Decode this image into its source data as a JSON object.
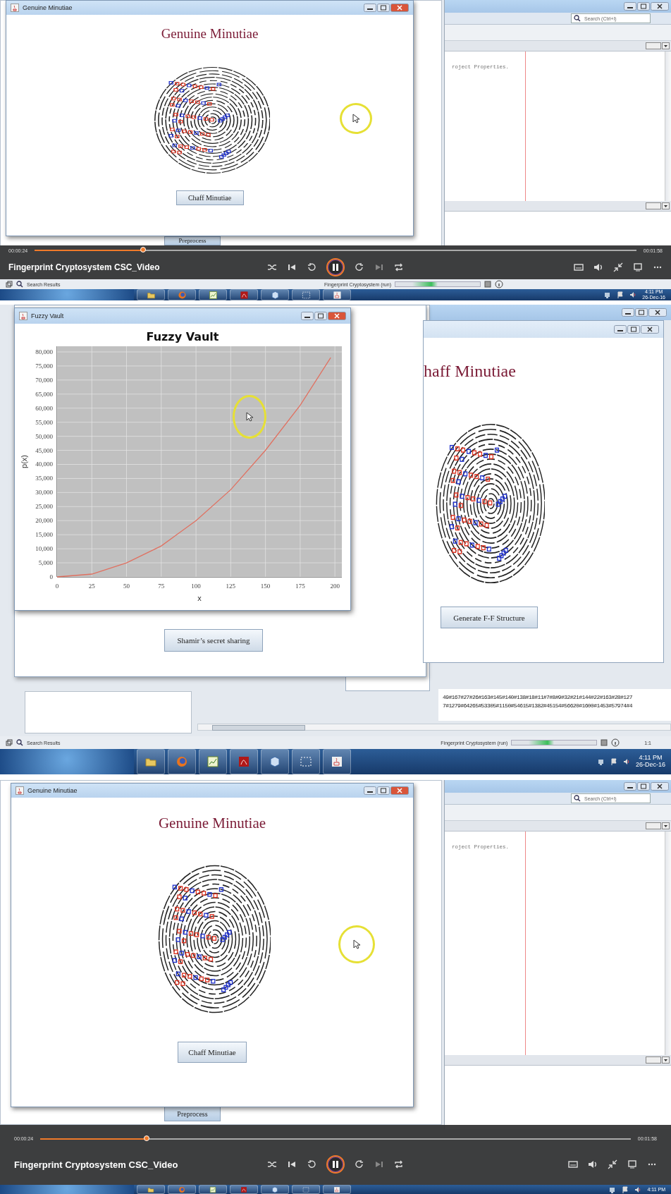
{
  "frames": [
    {
      "kind": "genuine",
      "ide": {
        "search_placeholder": "Search (Ctrl+I)",
        "editor_text": "roject Properties."
      },
      "back_window": {
        "button": "Preprocess"
      },
      "window": {
        "title": "Genuine Minutiae",
        "heading": "Genuine Minutiae",
        "button": "Chaff Minutiae"
      },
      "player": {
        "elapsed": "00:00:24",
        "total": "00:01:58",
        "level": 0.18,
        "playing": true,
        "title": "Fingerprint Cryptosystem CSC_Video"
      },
      "status_bar": {
        "search_results": "Search Results",
        "task": "Fingerprint Cryptosystem (run)",
        "task_progress": {
          "level": 0.5
        }
      },
      "taskbar": {
        "time": "4:11 PM",
        "date": "26-Dec-16"
      }
    },
    {
      "kind": "fuzzy",
      "back_window": {
        "button": "Shamir’s secret sharing"
      },
      "chaff_window": {
        "heading": "haff Minutiae",
        "button": "Generate F-F Structure"
      },
      "chart_window": {
        "title": "Fuzzy Vault",
        "chart_data": {
          "type": "line",
          "title": "Fuzzy Vault",
          "xlabel": "x",
          "ylabel": "p(x)",
          "x": [
            0,
            25,
            50,
            75,
            100,
            125,
            150,
            175,
            197
          ],
          "grid": true,
          "series": [
            {
              "color": "#e07060",
              "values": [
                0,
                1000,
                5000,
                11000,
                20000,
                31000,
                45000,
                61000,
                78000
              ]
            }
          ],
          "xlim": [
            0,
            205
          ],
          "ylim": [
            0,
            82000
          ],
          "xticks": [
            0,
            25,
            50,
            75,
            100,
            125,
            150,
            175,
            200
          ],
          "yticks": [
            {
              "value": 0,
              "label": "0"
            },
            {
              "value": 5000,
              "label": "5,000"
            },
            {
              "value": 10000,
              "label": "10,000"
            },
            {
              "value": 15000,
              "label": "15,000"
            },
            {
              "value": 20000,
              "label": "20,000"
            },
            {
              "value": 25000,
              "label": "25,000"
            },
            {
              "value": 30000,
              "label": "30,000"
            },
            {
              "value": 35000,
              "label": "35,000"
            },
            {
              "value": 40000,
              "label": "40,000"
            },
            {
              "value": 45000,
              "label": "45,000"
            },
            {
              "value": 50000,
              "label": "50,000"
            },
            {
              "value": 55000,
              "label": "55,000"
            },
            {
              "value": 60000,
              "label": "60,000"
            },
            {
              "value": 65000,
              "label": "65,000"
            },
            {
              "value": 70000,
              "label": "70,000"
            },
            {
              "value": 75000,
              "label": "75,000"
            },
            {
              "value": 80000,
              "label": "80,000"
            }
          ]
        }
      },
      "output": {
        "lines": [
          "49#167#27#26#163#145#140#138#18#11#7#8#9#32#21#144#22#163#28#127",
          "7#1279#64265#53305#1150#54615#1382#45154#56620#1600#1453#57974#4"
        ]
      },
      "status_bar": {
        "search_results": "Search Results",
        "task": "Fingerprint Cryptosystem (run)",
        "task_progress": {
          "level": 0.5
        },
        "position": "1:1"
      },
      "taskbar": {
        "time": "4:11 PM",
        "date": "26-Dec-16"
      }
    },
    {
      "kind": "genuine",
      "ide": {
        "search_placeholder": "Search (Ctrl+I)",
        "editor_text": "roject Properties."
      },
      "back_window": {
        "button": "Preprocess"
      },
      "window": {
        "title": "Genuine Minutiae",
        "heading": "Genuine Minutiae",
        "button": "Chaff Minutiae"
      },
      "player": {
        "elapsed": "00:00:24",
        "total": "00:01:58",
        "level": 0.18,
        "playing": true,
        "title": "Fingerprint Cryptosystem CSC_Video"
      },
      "taskbar": {
        "time": "4:11 PM"
      }
    }
  ]
}
